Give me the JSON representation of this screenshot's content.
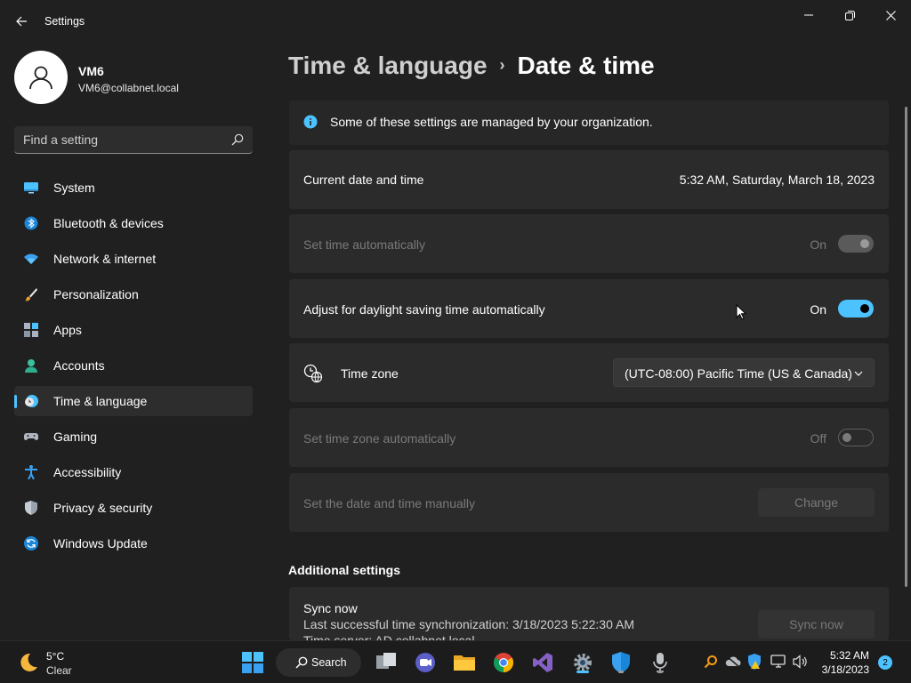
{
  "window": {
    "title": "Settings"
  },
  "profile": {
    "name": "VM6",
    "email": "VM6@collabnet.local"
  },
  "search": {
    "placeholder": "Find a setting"
  },
  "nav": {
    "items": [
      {
        "label": "System",
        "icon": "monitor-icon"
      },
      {
        "label": "Bluetooth & devices",
        "icon": "bluetooth-icon"
      },
      {
        "label": "Network & internet",
        "icon": "wifi-icon"
      },
      {
        "label": "Personalization",
        "icon": "brush-icon"
      },
      {
        "label": "Apps",
        "icon": "apps-icon"
      },
      {
        "label": "Accounts",
        "icon": "person-icon"
      },
      {
        "label": "Time & language",
        "icon": "clock-globe-icon",
        "active": true
      },
      {
        "label": "Gaming",
        "icon": "gamepad-icon"
      },
      {
        "label": "Accessibility",
        "icon": "accessibility-icon"
      },
      {
        "label": "Privacy & security",
        "icon": "shield-icon"
      },
      {
        "label": "Windows Update",
        "icon": "update-icon"
      }
    ]
  },
  "header": {
    "parent": "Time & language",
    "current": "Date & time"
  },
  "banner": {
    "text": "Some of these settings are managed by your organization."
  },
  "settings": {
    "current_datetime": {
      "label": "Current date and time",
      "value": "5:32 AM, Saturday, March 18, 2023"
    },
    "set_time_auto": {
      "label": "Set time automatically",
      "state": "On"
    },
    "daylight": {
      "label": "Adjust for daylight saving time automatically",
      "state": "On"
    },
    "time_zone": {
      "label": "Time zone",
      "value": "(UTC-08:00) Pacific Time (US & Canada)"
    },
    "set_timezone_auto": {
      "label": "Set time zone automatically",
      "state": "Off"
    },
    "manual": {
      "label": "Set the date and time manually",
      "button": "Change"
    }
  },
  "additional": {
    "title": "Additional settings",
    "sync_title": "Sync now",
    "last_sync": "Last successful time synchronization: 3/18/2023 5:22:30 AM",
    "time_server": "Time server: AD.collabnet.local",
    "sync_button": "Sync now"
  },
  "taskbar": {
    "weather_temp": "5°C",
    "weather_cond": "Clear",
    "search_label": "Search",
    "time": "5:32 AM",
    "date": "3/18/2023",
    "notifications": "2"
  },
  "colors": {
    "accent": "#4cc2ff",
    "background": "#202020",
    "card": "#2b2b2b"
  }
}
